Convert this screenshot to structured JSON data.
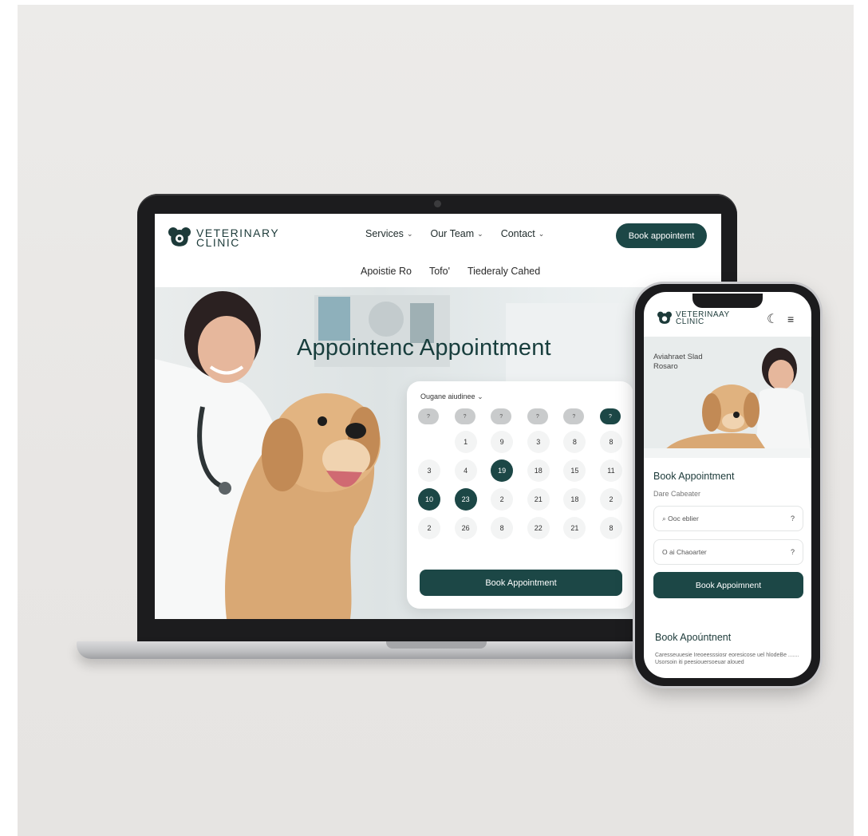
{
  "laptop": {
    "logo": {
      "line1": "VETERINARY",
      "line2": "CLINIC"
    },
    "nav": [
      {
        "label": "Services"
      },
      {
        "label": "Our Team"
      },
      {
        "label": "Contact"
      }
    ],
    "subnav": [
      {
        "label": "Apoistie Ro"
      },
      {
        "label": "Tofo'"
      },
      {
        "label": "Tiederaly Cahed"
      }
    ],
    "header_cta": "Book appointemt",
    "hero_title": "Appointenc Appointment",
    "calendar": {
      "month_label": "Ougane aiudinee",
      "weekday_heads": [
        "?",
        "?",
        "?",
        "?",
        "?",
        "?"
      ],
      "active_head_index": 5,
      "rows": [
        [
          "",
          "1",
          "9",
          "3",
          "8",
          "8"
        ],
        [
          "3",
          "4",
          "19",
          "18",
          "15",
          "11"
        ],
        [
          "10",
          "23",
          "2",
          "21",
          "18",
          "2"
        ],
        [
          "2",
          "26",
          "8",
          "22",
          "21",
          "8"
        ]
      ],
      "selected": [
        "1-2",
        "2-0",
        "2-1"
      ],
      "button_label": "Book Appointment"
    }
  },
  "phone": {
    "logo": {
      "line1": "VETERINAAY",
      "line2": "CLINIC"
    },
    "hero_text": "Aviahraet Slad Rosaro",
    "title": "Book Appointment",
    "subtitle": "Dare Cabeater",
    "field_1": "Ooc eblier",
    "field_2": "O ai Chaoarter",
    "field_icon": "?",
    "button_label": "Book Appoimnent",
    "title_2": "Book Apoúntnent",
    "small_text": "Caresseuuesie Ireoeesssiosr eoresicose uel hlodeBe ....... Usorsoin iti peesiouersoeuar aloued"
  },
  "colors": {
    "accent": "#1c4746",
    "background": "#e9e7e5"
  },
  "icons": [
    "paw-logo-icon",
    "chevron-down-icon",
    "moon-icon",
    "menu-icon",
    "location-icon"
  ]
}
